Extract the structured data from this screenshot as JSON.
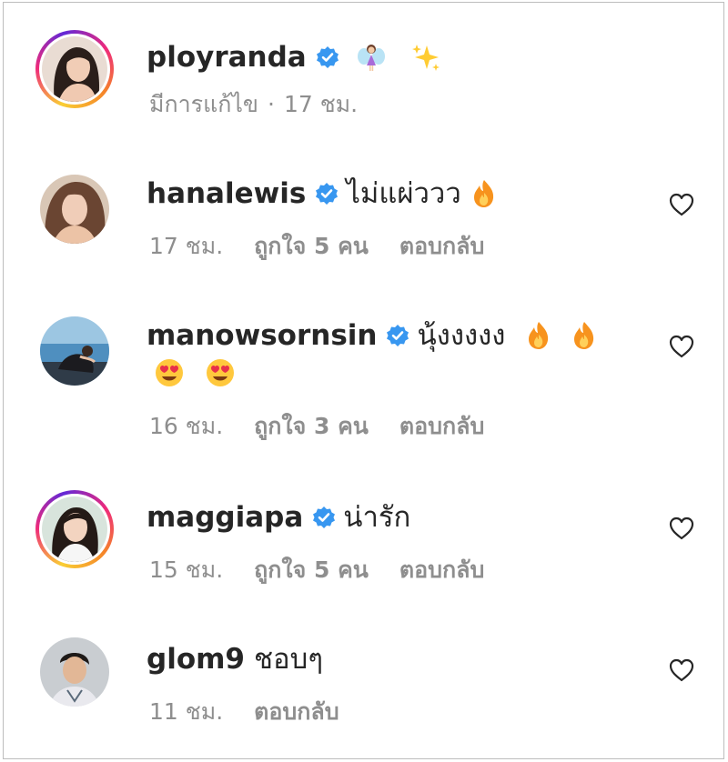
{
  "post": {
    "username": "ployranda",
    "verified": true,
    "emoji": [
      "fairy-emoji",
      "sparkles-emoji"
    ],
    "meta_edited": "มีการแก้ไข",
    "meta_separator": "·",
    "meta_time": "17 ชม."
  },
  "comments": [
    {
      "username": "hanalewis",
      "verified": true,
      "text": "ไม่แผ่ววว",
      "emoji": [
        "fire-emoji"
      ],
      "time": "17 ชม.",
      "likes": "ถูกใจ 5 คน",
      "reply": "ตอบกลับ",
      "story_ring": false
    },
    {
      "username": "manowsornsin",
      "verified": true,
      "text": "นุ้งงงงง",
      "emoji": [
        "fire-emoji",
        "fire-emoji",
        "heart-eyes-emoji",
        "heart-eyes-emoji"
      ],
      "time": "16 ชม.",
      "likes": "ถูกใจ 3 คน",
      "reply": "ตอบกลับ",
      "story_ring": false
    },
    {
      "username": "maggiapa",
      "verified": true,
      "text": "น่ารัก",
      "emoji": [],
      "time": "15 ชม.",
      "likes": "ถูกใจ 5 คน",
      "reply": "ตอบกลับ",
      "story_ring": true
    },
    {
      "username": "glom9",
      "verified": false,
      "text": "ชอบๆ",
      "emoji": [],
      "time": "11 ชม.",
      "reply": "ตอบกลับ",
      "story_ring": false
    }
  ],
  "colors": {
    "verified_blue": "#3897f0",
    "meta_gray": "#8e8e8e",
    "text": "#262626",
    "heart_outline": "#262626"
  }
}
